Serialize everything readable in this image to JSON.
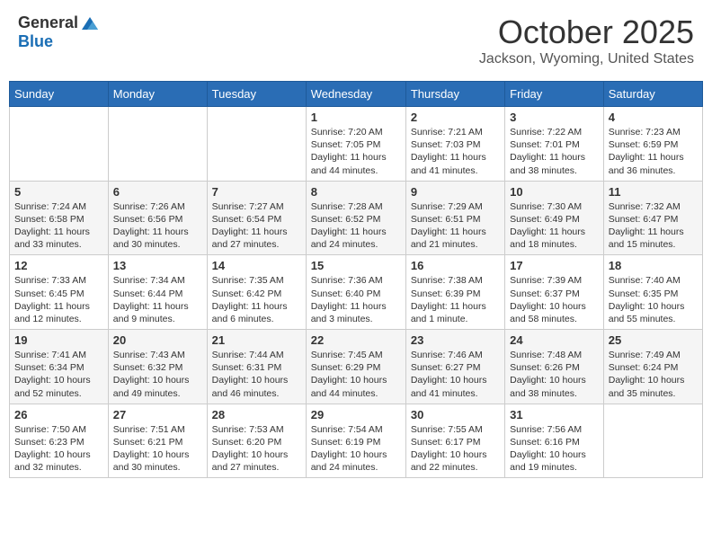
{
  "header": {
    "logo_general": "General",
    "logo_blue": "Blue",
    "month_title": "October 2025",
    "location": "Jackson, Wyoming, United States"
  },
  "days_of_week": [
    "Sunday",
    "Monday",
    "Tuesday",
    "Wednesday",
    "Thursday",
    "Friday",
    "Saturday"
  ],
  "weeks": [
    [
      {
        "day": "",
        "info": ""
      },
      {
        "day": "",
        "info": ""
      },
      {
        "day": "",
        "info": ""
      },
      {
        "day": "1",
        "info": "Sunrise: 7:20 AM\nSunset: 7:05 PM\nDaylight: 11 hours and 44 minutes."
      },
      {
        "day": "2",
        "info": "Sunrise: 7:21 AM\nSunset: 7:03 PM\nDaylight: 11 hours and 41 minutes."
      },
      {
        "day": "3",
        "info": "Sunrise: 7:22 AM\nSunset: 7:01 PM\nDaylight: 11 hours and 38 minutes."
      },
      {
        "day": "4",
        "info": "Sunrise: 7:23 AM\nSunset: 6:59 PM\nDaylight: 11 hours and 36 minutes."
      }
    ],
    [
      {
        "day": "5",
        "info": "Sunrise: 7:24 AM\nSunset: 6:58 PM\nDaylight: 11 hours and 33 minutes."
      },
      {
        "day": "6",
        "info": "Sunrise: 7:26 AM\nSunset: 6:56 PM\nDaylight: 11 hours and 30 minutes."
      },
      {
        "day": "7",
        "info": "Sunrise: 7:27 AM\nSunset: 6:54 PM\nDaylight: 11 hours and 27 minutes."
      },
      {
        "day": "8",
        "info": "Sunrise: 7:28 AM\nSunset: 6:52 PM\nDaylight: 11 hours and 24 minutes."
      },
      {
        "day": "9",
        "info": "Sunrise: 7:29 AM\nSunset: 6:51 PM\nDaylight: 11 hours and 21 minutes."
      },
      {
        "day": "10",
        "info": "Sunrise: 7:30 AM\nSunset: 6:49 PM\nDaylight: 11 hours and 18 minutes."
      },
      {
        "day": "11",
        "info": "Sunrise: 7:32 AM\nSunset: 6:47 PM\nDaylight: 11 hours and 15 minutes."
      }
    ],
    [
      {
        "day": "12",
        "info": "Sunrise: 7:33 AM\nSunset: 6:45 PM\nDaylight: 11 hours and 12 minutes."
      },
      {
        "day": "13",
        "info": "Sunrise: 7:34 AM\nSunset: 6:44 PM\nDaylight: 11 hours and 9 minutes."
      },
      {
        "day": "14",
        "info": "Sunrise: 7:35 AM\nSunset: 6:42 PM\nDaylight: 11 hours and 6 minutes."
      },
      {
        "day": "15",
        "info": "Sunrise: 7:36 AM\nSunset: 6:40 PM\nDaylight: 11 hours and 3 minutes."
      },
      {
        "day": "16",
        "info": "Sunrise: 7:38 AM\nSunset: 6:39 PM\nDaylight: 11 hours and 1 minute."
      },
      {
        "day": "17",
        "info": "Sunrise: 7:39 AM\nSunset: 6:37 PM\nDaylight: 10 hours and 58 minutes."
      },
      {
        "day": "18",
        "info": "Sunrise: 7:40 AM\nSunset: 6:35 PM\nDaylight: 10 hours and 55 minutes."
      }
    ],
    [
      {
        "day": "19",
        "info": "Sunrise: 7:41 AM\nSunset: 6:34 PM\nDaylight: 10 hours and 52 minutes."
      },
      {
        "day": "20",
        "info": "Sunrise: 7:43 AM\nSunset: 6:32 PM\nDaylight: 10 hours and 49 minutes."
      },
      {
        "day": "21",
        "info": "Sunrise: 7:44 AM\nSunset: 6:31 PM\nDaylight: 10 hours and 46 minutes."
      },
      {
        "day": "22",
        "info": "Sunrise: 7:45 AM\nSunset: 6:29 PM\nDaylight: 10 hours and 44 minutes."
      },
      {
        "day": "23",
        "info": "Sunrise: 7:46 AM\nSunset: 6:27 PM\nDaylight: 10 hours and 41 minutes."
      },
      {
        "day": "24",
        "info": "Sunrise: 7:48 AM\nSunset: 6:26 PM\nDaylight: 10 hours and 38 minutes."
      },
      {
        "day": "25",
        "info": "Sunrise: 7:49 AM\nSunset: 6:24 PM\nDaylight: 10 hours and 35 minutes."
      }
    ],
    [
      {
        "day": "26",
        "info": "Sunrise: 7:50 AM\nSunset: 6:23 PM\nDaylight: 10 hours and 32 minutes."
      },
      {
        "day": "27",
        "info": "Sunrise: 7:51 AM\nSunset: 6:21 PM\nDaylight: 10 hours and 30 minutes."
      },
      {
        "day": "28",
        "info": "Sunrise: 7:53 AM\nSunset: 6:20 PM\nDaylight: 10 hours and 27 minutes."
      },
      {
        "day": "29",
        "info": "Sunrise: 7:54 AM\nSunset: 6:19 PM\nDaylight: 10 hours and 24 minutes."
      },
      {
        "day": "30",
        "info": "Sunrise: 7:55 AM\nSunset: 6:17 PM\nDaylight: 10 hours and 22 minutes."
      },
      {
        "day": "31",
        "info": "Sunrise: 7:56 AM\nSunset: 6:16 PM\nDaylight: 10 hours and 19 minutes."
      },
      {
        "day": "",
        "info": ""
      }
    ]
  ]
}
